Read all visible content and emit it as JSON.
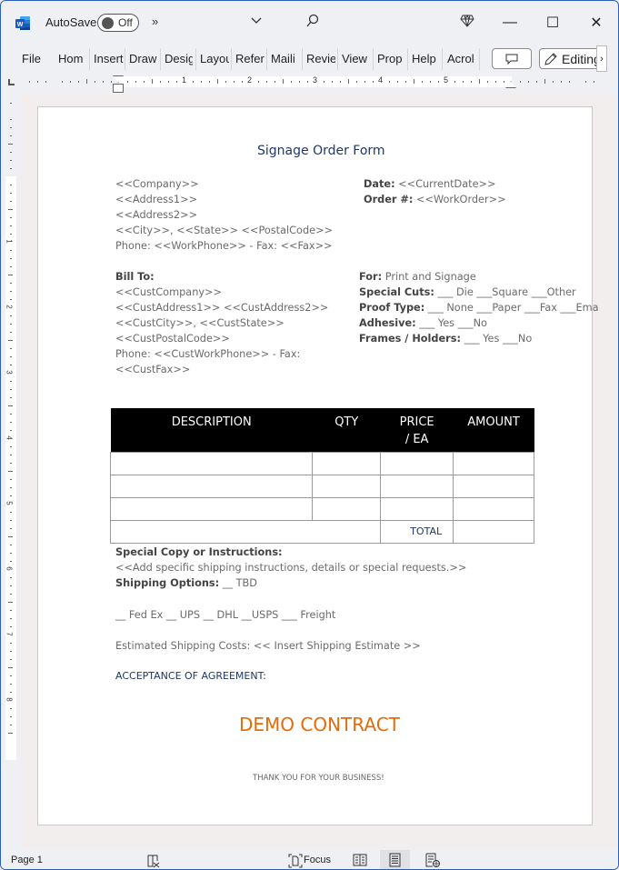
{
  "titlebar": {
    "app_icon": "word-icon",
    "autosave_label": "AutoSave",
    "autosave_state": "Off",
    "more_label": "»",
    "dropdown_icon": "chevron-down-icon",
    "search_icon": "search-icon",
    "premium_icon": "diamond-icon",
    "minimize_label": "—",
    "maximize_label": "☐",
    "close_label": "✕"
  },
  "ribbon": {
    "tabs": [
      "File",
      "Home",
      "Insert",
      "Draw",
      "Design",
      "Layout",
      "References",
      "Mailings",
      "Review",
      "View",
      "Properties",
      "Help",
      "Acrobat"
    ],
    "tabs_visible": [
      "File",
      "Hom",
      "Insert",
      "Draw",
      "Desig",
      "Layou",
      "Refer",
      "Maili",
      "Revie",
      "View",
      "Prop",
      "Help",
      "Acrol"
    ],
    "comment_icon": "comment-icon",
    "editing_label": "Editing",
    "scroll_label": "›"
  },
  "ruler": {
    "numbers": [
      "1",
      "2",
      "3",
      "4",
      "5"
    ],
    "vnumbers": [
      "1",
      "2",
      "3",
      "4",
      "5",
      "6",
      "7",
      "8"
    ]
  },
  "document": {
    "title": "Signage Order Form",
    "company_block": [
      "<<Company>>",
      "<<Address1>>",
      "<<Address2>>",
      "<<City>>, <<State>>  <<PostalCode>>",
      "Phone: <<WorkPhone>>  - Fax: <<Fax>>"
    ],
    "date_label": "Date:",
    "date_value": " <<CurrentDate>>",
    "order_label": "Order #:",
    "order_value": " <<WorkOrder>>",
    "bill_to_label": "Bill To:",
    "bill_to_lines": [
      "<<CustCompany>>",
      "<<CustAddress1>> <<CustAddress2>>",
      "<<CustCity>>, <<CustState>>",
      "<<CustPostalCode>>",
      "Phone: <<CustWorkPhone>>  - Fax:",
      "<<CustFax>>"
    ],
    "options": [
      {
        "label": "For:",
        "value": " Print and Signage"
      },
      {
        "label": "Special Cuts:",
        "value": " ___ Die   ___Square  ___Other"
      },
      {
        "label": "Proof Type:",
        "value": "   ___ None ___Paper   ___Fax ___Ema"
      },
      {
        "label": "Adhesive:",
        "value": " ___ Yes ___No"
      },
      {
        "label": "Frames / Holders:",
        "value": " ___ Yes ___No"
      }
    ],
    "table": {
      "headers": [
        "DESCRIPTION",
        "QTY",
        "PRICE / EA",
        "AMOUNT"
      ],
      "rows": [
        [
          "",
          "",
          "",
          ""
        ],
        [
          "",
          "",
          "",
          ""
        ],
        [
          "",
          "",
          "",
          ""
        ]
      ],
      "total_label": "TOTAL",
      "total_value": ""
    },
    "special_copy_label": "Special Copy or Instructions:",
    "special_copy_value": "<<Add specific shipping instructions, details or special requests.>>",
    "shipping_options_label": "Shipping Options:",
    "shipping_options_value": " __ TBD",
    "carriers": "__ Fed Ex   __ UPS   __ DHL   __USPS   ___ Freight",
    "estimated_costs": "Estimated Shipping Costs: << Insert Shipping Estimate >>",
    "acceptance": "ACCEPTANCE OF AGREEMENT:",
    "watermark": "DEMO CONTRACT",
    "thanks": "THANK YOU FOR YOUR BUSINESS!"
  },
  "statusbar": {
    "page": "Page 1",
    "proofing_icon": "proofing-icon",
    "focus_label": "Focus",
    "views": [
      "read-mode-icon",
      "print-layout-icon",
      "web-layout-icon"
    ],
    "active_view": "print-layout"
  },
  "colors": {
    "title": "#1f3864",
    "watermark": "#e36c0a",
    "table_header_bg": "#000000",
    "word_blue": "#185abd"
  }
}
